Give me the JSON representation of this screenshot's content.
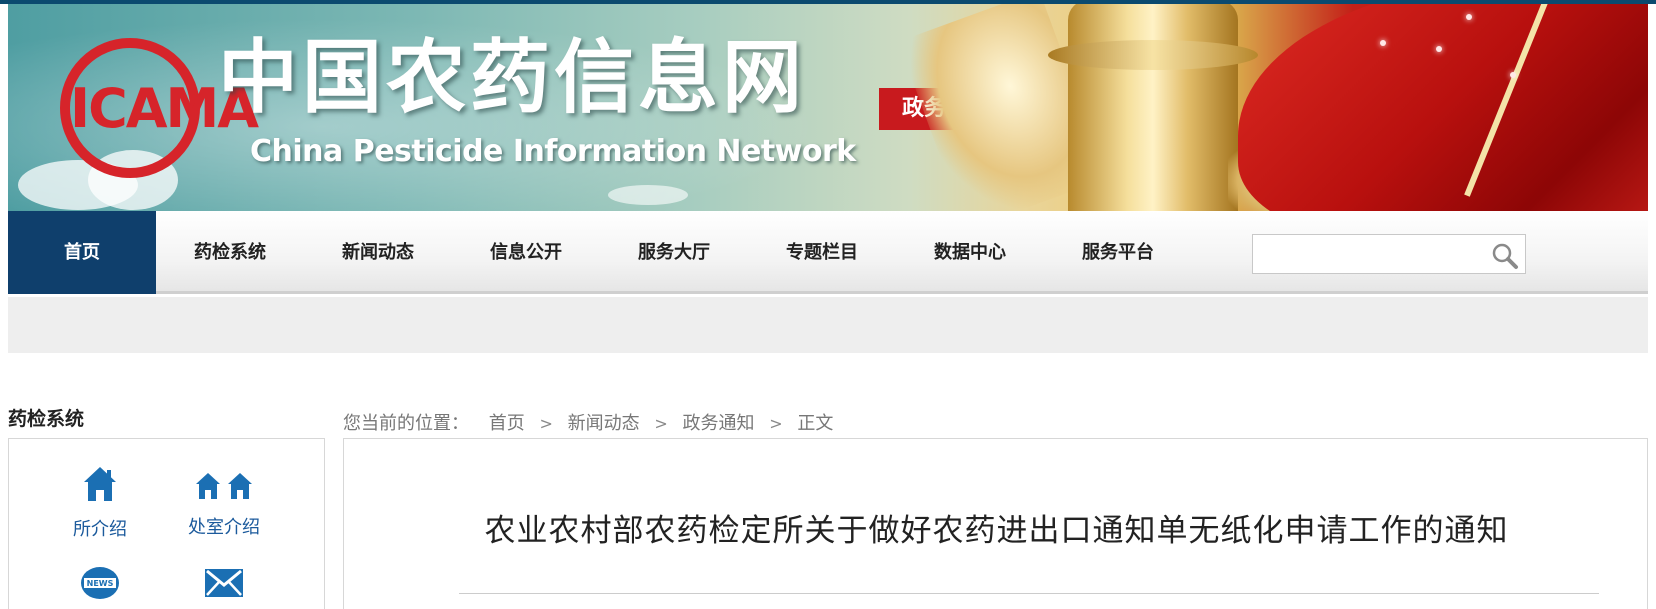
{
  "banner": {
    "logo_text": "ICAMA",
    "title": "中国农药信息网",
    "subtitle": "China Pesticide Information Network",
    "edition_badge": "政务版"
  },
  "nav": {
    "items": [
      {
        "label": "首页",
        "active": true
      },
      {
        "label": "药检系统",
        "active": false
      },
      {
        "label": "新闻动态",
        "active": false
      },
      {
        "label": "信息公开",
        "active": false
      },
      {
        "label": "服务大厅",
        "active": false
      },
      {
        "label": "专题栏目",
        "active": false
      },
      {
        "label": "数据中心",
        "active": false
      },
      {
        "label": "服务平台",
        "active": false
      }
    ],
    "search": {
      "value": "",
      "placeholder": "",
      "icon": "search-icon"
    }
  },
  "sidebar": {
    "title": "药检系统",
    "links": [
      {
        "label": "所介绍",
        "icon": "house-icon"
      },
      {
        "label": "处室介绍",
        "icon": "two-houses-icon"
      },
      {
        "label": "",
        "icon": "news-globe-icon"
      },
      {
        "label": "",
        "icon": "envelope-icon"
      }
    ]
  },
  "breadcrumb": {
    "lead": "您当前的位置：",
    "items": [
      "首页",
      "新闻动态",
      "政务通知",
      "正文"
    ],
    "separator": ">"
  },
  "article": {
    "title": "农业农村部农药检定所关于做好农药进出口通知单无纸化申请工作的通知"
  },
  "colors": {
    "nav_active": "#0f3f6c",
    "brand_red": "#c81a1e",
    "link_blue": "#1b5a9c"
  }
}
